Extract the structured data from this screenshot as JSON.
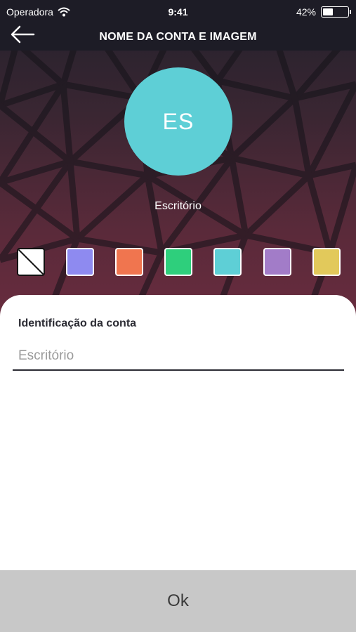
{
  "status_bar": {
    "carrier": "Operadora",
    "time": "9:41",
    "battery_percent": "42%",
    "battery_level": 0.42,
    "wifi_icon": "wifi-icon"
  },
  "nav": {
    "back_icon": "arrow-left-icon",
    "title": "NOME DA CONTA E IMAGEM"
  },
  "avatar": {
    "initials": "ES",
    "color": "#5ecfd6",
    "name": "Escritório"
  },
  "swatches": [
    {
      "name": "none",
      "color": "#ffffff",
      "selected": true
    },
    {
      "name": "blue-violet",
      "color": "#8e8af0"
    },
    {
      "name": "orange",
      "color": "#f0754f"
    },
    {
      "name": "green",
      "color": "#2ecf7c"
    },
    {
      "name": "cyan",
      "color": "#5ecfd6"
    },
    {
      "name": "purple",
      "color": "#a27cc8"
    },
    {
      "name": "yellow",
      "color": "#e2c95b"
    }
  ],
  "form": {
    "label": "Identificação da conta",
    "value": "",
    "placeholder": "Escritório"
  },
  "ok_button": {
    "label": "Ok"
  }
}
